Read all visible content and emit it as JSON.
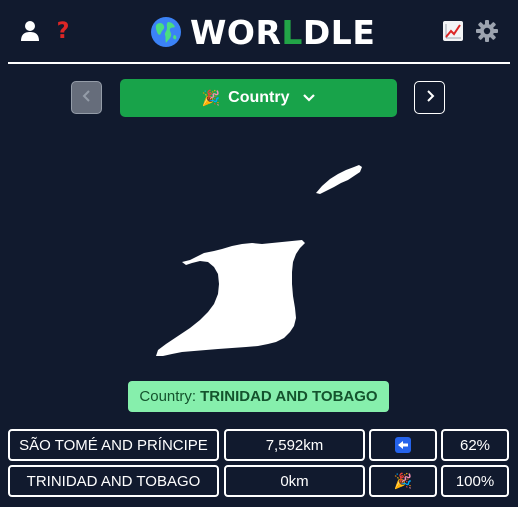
{
  "header": {
    "title_prefix": "WOR",
    "title_highlight": "L",
    "title_suffix": "DLE",
    "icons": {
      "account": "user-icon",
      "help": "question-mark-icon",
      "logo": "globe-icon",
      "stats": "chart-icon",
      "settings": "gear-icon"
    },
    "highlight_color": "#22a447"
  },
  "nav": {
    "mode_label": "Country",
    "mode_emoji": "🎉",
    "prev_icon": "chevron-left-icon",
    "next_icon": "chevron-right-icon",
    "dropdown_icon": "chevron-down-icon"
  },
  "answer": {
    "label": "Country:",
    "value": "TRINIDAD AND TOBAGO"
  },
  "guesses": [
    {
      "name": "SÃO TOMÉ AND PRÍNCIPE",
      "distance": "7,592km",
      "direction": "left-arrow-icon",
      "percent": "62%"
    },
    {
      "name": "TRINIDAD AND TOBAGO",
      "distance": "0km",
      "direction": "party-popper-icon",
      "percent": "100%"
    }
  ],
  "colors": {
    "background": "#111a2e",
    "mode_button": "#18a34a",
    "answer_bg": "#86efac",
    "answer_text": "#14532d"
  }
}
